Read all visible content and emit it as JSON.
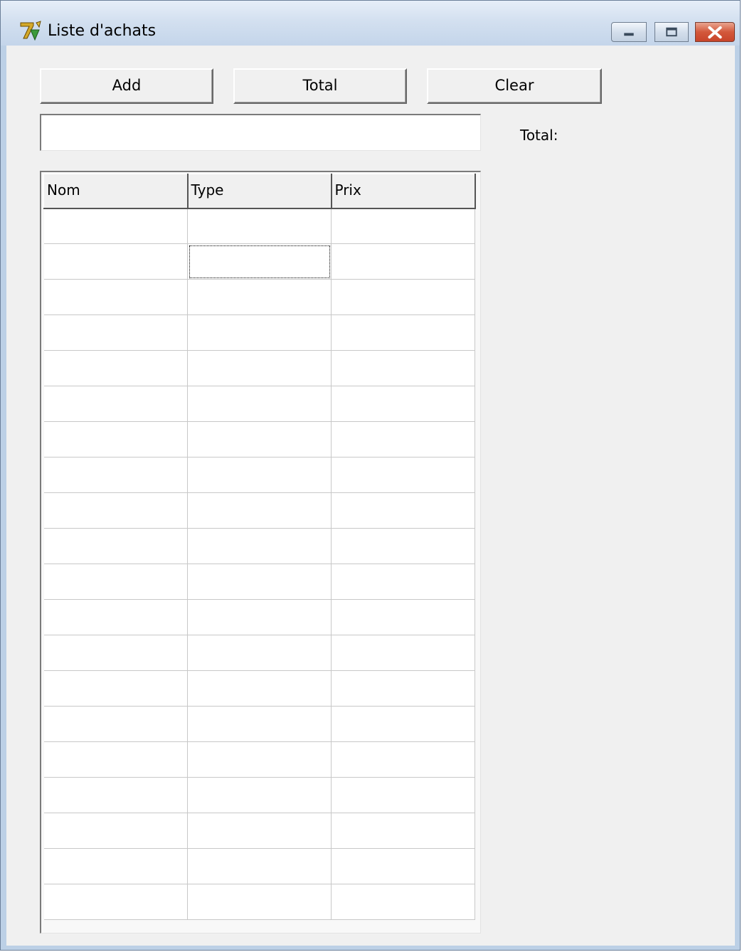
{
  "window": {
    "title": "Liste d'achats",
    "icon": "delphi-app-icon",
    "controls": [
      "minimize-icon",
      "maximize-icon",
      "close-icon"
    ]
  },
  "toolbar": {
    "add_label": "Add",
    "total_label": "Total",
    "clear_label": "Clear"
  },
  "entry": {
    "value": "",
    "placeholder": ""
  },
  "total": {
    "label": "Total:"
  },
  "table": {
    "columns": [
      "Nom",
      "Type",
      "Prix"
    ],
    "row_count": 20,
    "focused_cell": {
      "row": 1,
      "column": 1
    }
  },
  "colors": {
    "face": "#f0f0f0",
    "title_gradient": "#d3e0f0",
    "close_button": "#c8442a"
  }
}
